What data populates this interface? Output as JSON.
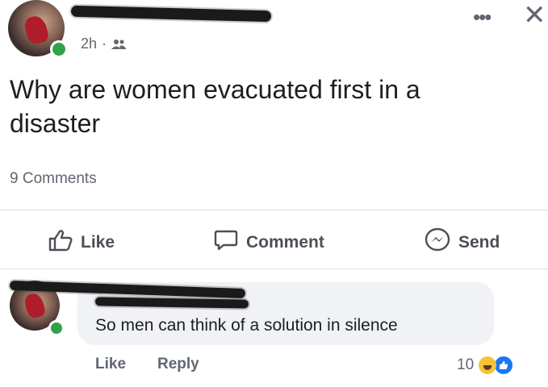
{
  "post": {
    "time": "2h",
    "separator": "·",
    "text_line1": "Why are women evacuated first in a",
    "text_line2": "disaster",
    "comments_count": "9 Comments"
  },
  "header": {
    "more_glyph": "•••",
    "close_glyph": "✕"
  },
  "actions": {
    "like": "Like",
    "comment": "Comment",
    "send": "Send"
  },
  "comment": {
    "text": "So men can think of a solution in silence",
    "like": "Like",
    "reply": "Reply",
    "reaction_count": "10"
  },
  "icons": {
    "friends": "friends-icon",
    "like": "thumbs-up-icon",
    "comment": "speech-bubble-icon",
    "send": "messenger-icon"
  },
  "colors": {
    "online": "#31a24c",
    "meta": "#65676b",
    "bubble": "#f0f2f5",
    "like_reaction": "#1877f2",
    "haha_reaction": "#f7c23b"
  }
}
